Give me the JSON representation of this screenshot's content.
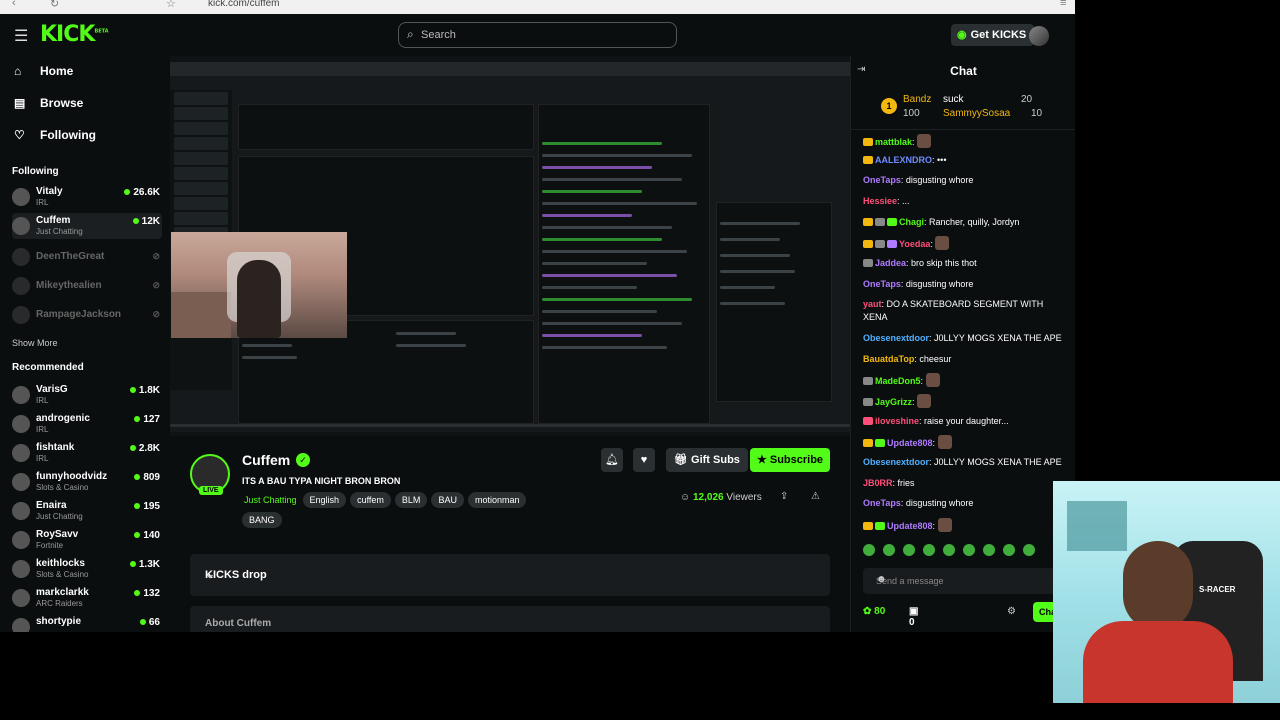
{
  "browser": {
    "url": "kick.com/cuffem"
  },
  "topbar": {
    "logo": "KICK",
    "logo_badge": "BETA",
    "search_placeholder": "Search",
    "get_kicks": "Get KICKS"
  },
  "sidebar": {
    "nav": [
      {
        "label": "Home",
        "icon": "home-icon"
      },
      {
        "label": "Browse",
        "icon": "browse-icon"
      },
      {
        "label": "Following",
        "icon": "heart-icon"
      }
    ],
    "following_title": "Following",
    "following": [
      {
        "name": "Vitaly",
        "category": "IRL",
        "viewers": "26.6K",
        "live": true
      },
      {
        "name": "Cuffem",
        "category": "Just Chatting",
        "viewers": "12K",
        "live": true
      },
      {
        "name": "DeenTheGreat",
        "category": "",
        "viewers": "",
        "live": false
      },
      {
        "name": "Mikeythealien",
        "category": "",
        "viewers": "",
        "live": false
      },
      {
        "name": "RampageJackson",
        "category": "",
        "viewers": "",
        "live": false
      }
    ],
    "show_more": "Show More",
    "recommended_title": "Recommended",
    "recommended": [
      {
        "name": "VarisG",
        "category": "IRL",
        "viewers": "1.8K"
      },
      {
        "name": "androgenic",
        "category": "IRL",
        "viewers": "127"
      },
      {
        "name": "fishtank",
        "category": "IRL",
        "viewers": "2.8K"
      },
      {
        "name": "funnyhoodvidz",
        "category": "Slots & Casino",
        "viewers": "809"
      },
      {
        "name": "Enaira",
        "category": "Just Chatting",
        "viewers": "195"
      },
      {
        "name": "RoySavv",
        "category": "Fortnite",
        "viewers": "140"
      },
      {
        "name": "keithlocks",
        "category": "Slots & Casino",
        "viewers": "1.3K"
      },
      {
        "name": "markclarkk",
        "category": "ARC Raiders",
        "viewers": "132"
      },
      {
        "name": "shortypie",
        "category": "",
        "viewers": "66"
      }
    ]
  },
  "stream": {
    "streamer": "Cuffem",
    "live_label": "LIVE",
    "title": "ITS A BAU TYPA NIGHT BRON BRON",
    "category": "Just Chatting",
    "tags": [
      "English",
      "cuffem",
      "BLM",
      "BAU",
      "motionman",
      "BANG"
    ],
    "gift_subs": "Gift Subs",
    "subscribe": "Subscribe",
    "viewers": "12,026",
    "viewers_label": "Viewers",
    "kicks_drop": "KICKS drop",
    "about": "About Cuffem"
  },
  "chat": {
    "title": "Chat",
    "pinned": {
      "rank": "1",
      "user1": "Bandz",
      "amount1": "100",
      "user2": "suck",
      "user2b": "SammyySosaa",
      "count1": "20",
      "count2": "10"
    },
    "messages": [
      {
        "user": "mattblak",
        "color": "#f2b80f",
        "text": ""
      },
      {
        "user": "AALEXNDRO",
        "color": "#6f8cff",
        "text": "•••"
      },
      {
        "user": "OneTaps",
        "color": "#b07cff",
        "text": "disgusting whore"
      },
      {
        "user": "Hessiee",
        "color": "#ff4f7a",
        "text": "..."
      },
      {
        "user": "Chagi",
        "color": "#53fc18",
        "text": "Rancher, quilly, Jordyn"
      },
      {
        "user": "Yoedaa",
        "color": "#ff4f7a",
        "text": ""
      },
      {
        "user": "Jaddea",
        "color": "#b07cff",
        "text": "bro skip this thot"
      },
      {
        "user": "OneTaps",
        "color": "#b07cff",
        "text": "disgusting whore"
      },
      {
        "user": "yaut",
        "color": "#ff4f7a",
        "text": "DO A SKATEBOARD SEGMENT WITH XENA"
      },
      {
        "user": "Obesenextdoor",
        "color": "#4fb0ff",
        "text": "J0LLYY MOGS XENA THE APE"
      },
      {
        "user": "BauatdaTop",
        "color": "#f2b80f",
        "text": "cheesur"
      },
      {
        "user": "MadeDon5",
        "color": "#53fc18",
        "text": ""
      },
      {
        "user": "JayGrizz",
        "color": "#53fc18",
        "text": ""
      },
      {
        "user": "iloveshine",
        "color": "#ff4f7a",
        "text": "raise your daughter..."
      },
      {
        "user": "Update808",
        "color": "#b07cff",
        "text": ""
      },
      {
        "user": "Obesenextdoor",
        "color": "#4fb0ff",
        "text": "J0LLYY MOGS XENA THE APE"
      },
      {
        "user": "JB0RR",
        "color": "#ff4f7a",
        "text": "fries"
      },
      {
        "user": "OneTaps",
        "color": "#b07cff",
        "text": "disgusting whore"
      },
      {
        "user": "Update808",
        "color": "#b07cff",
        "text": ""
      }
    ],
    "send_placeholder": "Send a message",
    "points": "80",
    "gifts": "0",
    "chat_button": "Chat"
  },
  "facecam": {
    "brand": "S-RACER"
  },
  "colors": {
    "accent": "#53fc18",
    "bg": "#0b0e0f",
    "panel": "#191c1e"
  }
}
